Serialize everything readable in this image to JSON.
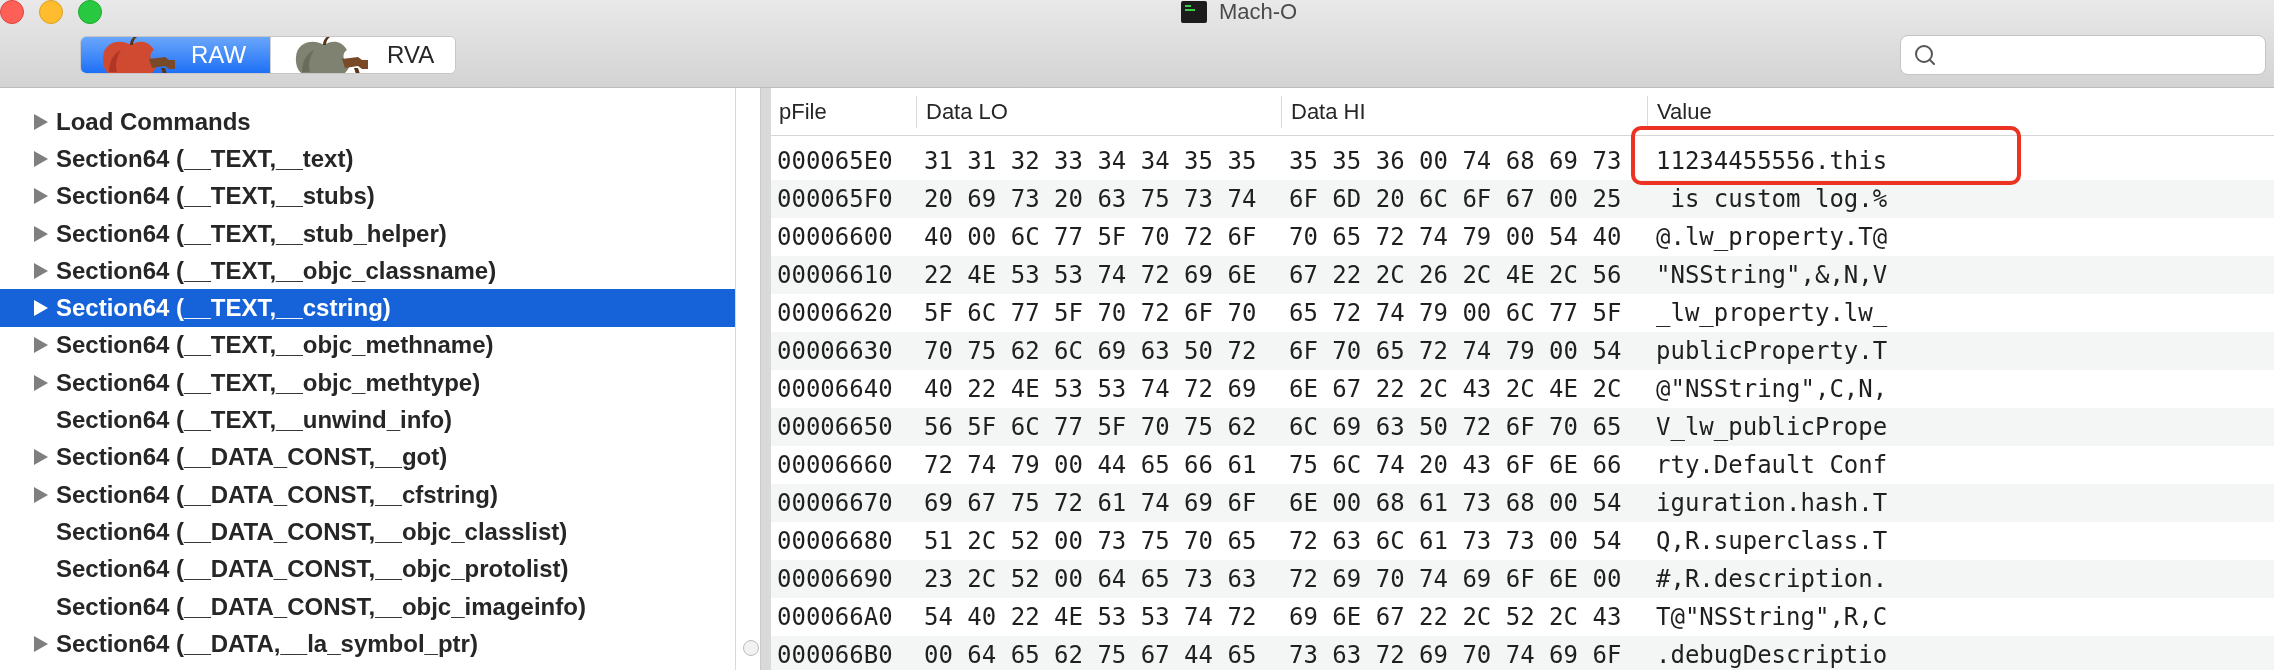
{
  "window": {
    "title": "Mach-O"
  },
  "toolbar": {
    "modes": [
      {
        "label": "RAW",
        "selected": true
      },
      {
        "label": "RVA",
        "selected": false
      }
    ]
  },
  "sidebar": {
    "items": [
      {
        "label": "Load Commands",
        "kind": "group",
        "expanded": false,
        "selected": false
      },
      {
        "label": "Section64 (__TEXT,__text)",
        "kind": "group",
        "expanded": false,
        "selected": false
      },
      {
        "label": "Section64 (__TEXT,__stubs)",
        "kind": "group",
        "expanded": false,
        "selected": false
      },
      {
        "label": "Section64 (__TEXT,__stub_helper)",
        "kind": "group",
        "expanded": false,
        "selected": false
      },
      {
        "label": "Section64 (__TEXT,__objc_classname)",
        "kind": "group",
        "expanded": false,
        "selected": false
      },
      {
        "label": "Section64 (__TEXT,__cstring)",
        "kind": "group",
        "expanded": false,
        "selected": true
      },
      {
        "label": "Section64 (__TEXT,__objc_methname)",
        "kind": "group",
        "expanded": false,
        "selected": false
      },
      {
        "label": "Section64 (__TEXT,__objc_methtype)",
        "kind": "group",
        "expanded": false,
        "selected": false
      },
      {
        "label": "Section64 (__TEXT,__unwind_info)",
        "kind": "leaf",
        "selected": false
      },
      {
        "label": "Section64 (__DATA_CONST,__got)",
        "kind": "group",
        "expanded": false,
        "selected": false
      },
      {
        "label": "Section64 (__DATA_CONST,__cfstring)",
        "kind": "group",
        "expanded": false,
        "selected": false
      },
      {
        "label": "Section64 (__DATA_CONST,__objc_classlist)",
        "kind": "leaf",
        "selected": false
      },
      {
        "label": "Section64 (__DATA_CONST,__objc_protolist)",
        "kind": "leaf",
        "selected": false
      },
      {
        "label": "Section64 (__DATA_CONST,__objc_imageinfo)",
        "kind": "leaf",
        "selected": false
      },
      {
        "label": "Section64 (__DATA,__la_symbol_ptr)",
        "kind": "group",
        "expanded": false,
        "selected": false
      }
    ]
  },
  "table": {
    "columns": [
      "pFile",
      "Data LO",
      "Data HI",
      "Value"
    ],
    "rows": [
      {
        "pfile": "000065E0",
        "data_lo": "31 31 32 33 34 34 35 35",
        "data_hi": "35 35 36 00 74 68 69 73",
        "value": "11234455556.this",
        "boxed": true
      },
      {
        "pfile": "000065F0",
        "data_lo": "20 69 73 20 63 75 73 74",
        "data_hi": "6F 6D 20 6C 6F 67 00 25",
        "value": " is custom log.%",
        "boxed": false
      },
      {
        "pfile": "00006600",
        "data_lo": "40 00 6C 77 5F 70 72 6F",
        "data_hi": "70 65 72 74 79 00 54 40",
        "value": "@.lw_property.T@",
        "boxed": false
      },
      {
        "pfile": "00006610",
        "data_lo": "22 4E 53 53 74 72 69 6E",
        "data_hi": "67 22 2C 26 2C 4E 2C 56",
        "value": "\"NSString\",&,N,V",
        "boxed": false
      },
      {
        "pfile": "00006620",
        "data_lo": "5F 6C 77 5F 70 72 6F 70",
        "data_hi": "65 72 74 79 00 6C 77 5F",
        "value": "_lw_property.lw_",
        "boxed": false
      },
      {
        "pfile": "00006630",
        "data_lo": "70 75 62 6C 69 63 50 72",
        "data_hi": "6F 70 65 72 74 79 00 54",
        "value": "publicProperty.T",
        "boxed": false
      },
      {
        "pfile": "00006640",
        "data_lo": "40 22 4E 53 53 74 72 69",
        "data_hi": "6E 67 22 2C 43 2C 4E 2C",
        "value": "@\"NSString\",C,N,",
        "boxed": false
      },
      {
        "pfile": "00006650",
        "data_lo": "56 5F 6C 77 5F 70 75 62",
        "data_hi": "6C 69 63 50 72 6F 70 65",
        "value": "V_lw_publicPrope",
        "boxed": false
      },
      {
        "pfile": "00006660",
        "data_lo": "72 74 79 00 44 65 66 61",
        "data_hi": "75 6C 74 20 43 6F 6E 66",
        "value": "rty.Default Conf",
        "boxed": false
      },
      {
        "pfile": "00006670",
        "data_lo": "69 67 75 72 61 74 69 6F",
        "data_hi": "6E 00 68 61 73 68 00 54",
        "value": "iguration.hash.T",
        "boxed": false
      },
      {
        "pfile": "00006680",
        "data_lo": "51 2C 52 00 73 75 70 65",
        "data_hi": "72 63 6C 61 73 73 00 54",
        "value": "Q,R.superclass.T",
        "boxed": false
      },
      {
        "pfile": "00006690",
        "data_lo": "23 2C 52 00 64 65 73 63",
        "data_hi": "72 69 70 74 69 6F 6E 00",
        "value": "#,R.description.",
        "boxed": false
      },
      {
        "pfile": "000066A0",
        "data_lo": "54 40 22 4E 53 53 74 72",
        "data_hi": "69 6E 67 22 2C 52 2C 43",
        "value": "T@\"NSString\",R,C",
        "boxed": false
      },
      {
        "pfile": "000066B0",
        "data_lo": "00 64 65 62 75 67 44 65",
        "data_hi": "73 63 72 69 70 74 69 6F",
        "value": ".debugDescriptio",
        "boxed": false
      }
    ]
  }
}
